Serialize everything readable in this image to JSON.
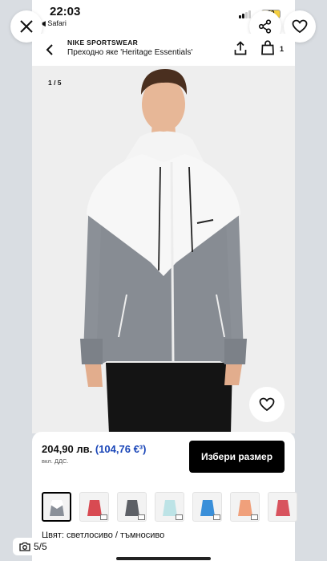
{
  "status": {
    "time": "22:03",
    "back_app": "◀ Safari",
    "battery": "59"
  },
  "header": {
    "brand": "NIKE SPORTSWEAR",
    "product_name": "Преходно яке 'Heritage Essentials'",
    "cart_count": "1"
  },
  "gallery": {
    "counter": "1 / 5"
  },
  "price": {
    "main": "204,90 лв.",
    "eur": "(104,76 €³)",
    "vat": "вкл. ДДС."
  },
  "cta": {
    "label": "Избери размер"
  },
  "color": {
    "label": "Цвят: светлосиво / тъмносиво"
  },
  "thumbnails": [
    {
      "color": "#8a9099",
      "selected": true
    },
    {
      "color": "#d84a52"
    },
    {
      "color": "#5d6066"
    },
    {
      "color": "#bde3e6"
    },
    {
      "color": "#3a8fd9"
    },
    {
      "color": "#f0a07b"
    },
    {
      "color": "#d8535e"
    }
  ],
  "overlay": {
    "photo_count": "5/5"
  },
  "icons": [
    "close-icon",
    "share-icon",
    "heart-icon",
    "back-arrow-icon",
    "upload-icon",
    "bag-icon",
    "camera-icon"
  ]
}
